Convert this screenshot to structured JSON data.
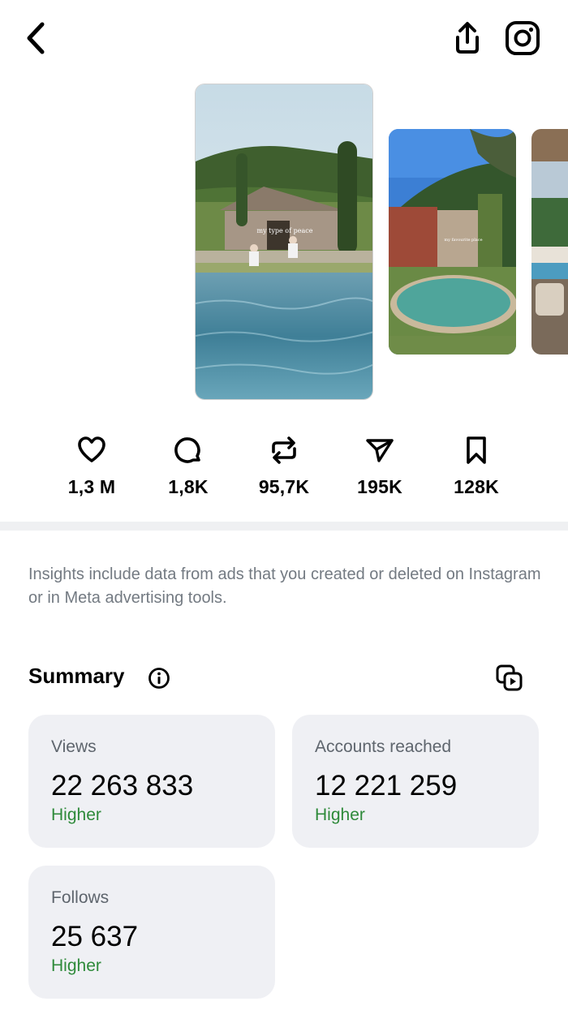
{
  "header": {
    "back_icon": "chevron-left-icon",
    "share_icon": "share-upload-icon",
    "instagram_icon": "instagram-icon"
  },
  "carousel": {
    "main_caption": "my type of peace",
    "second_caption": "my favourite place"
  },
  "stats": [
    {
      "icon": "heart-icon",
      "value": "1,3 M"
    },
    {
      "icon": "comment-icon",
      "value": "1,8K"
    },
    {
      "icon": "repost-icon",
      "value": "95,7K"
    },
    {
      "icon": "send-icon",
      "value": "195K"
    },
    {
      "icon": "bookmark-icon",
      "value": "128K"
    }
  ],
  "disclaimer": "Insights include data from ads that you created or deleted on Instagram or in Meta advertising tools.",
  "summary": {
    "title": "Summary",
    "cards": [
      {
        "label": "Views",
        "value": "22 263 833",
        "trend": "Higher"
      },
      {
        "label": "Accounts reached",
        "value": "12 221 259",
        "trend": "Higher"
      },
      {
        "label": "Follows",
        "value": "25 637",
        "trend": "Higher"
      }
    ]
  },
  "colors": {
    "trend_positive": "#2e8a3a",
    "card_bg": "#eff0f4",
    "muted_text": "#737a82"
  }
}
